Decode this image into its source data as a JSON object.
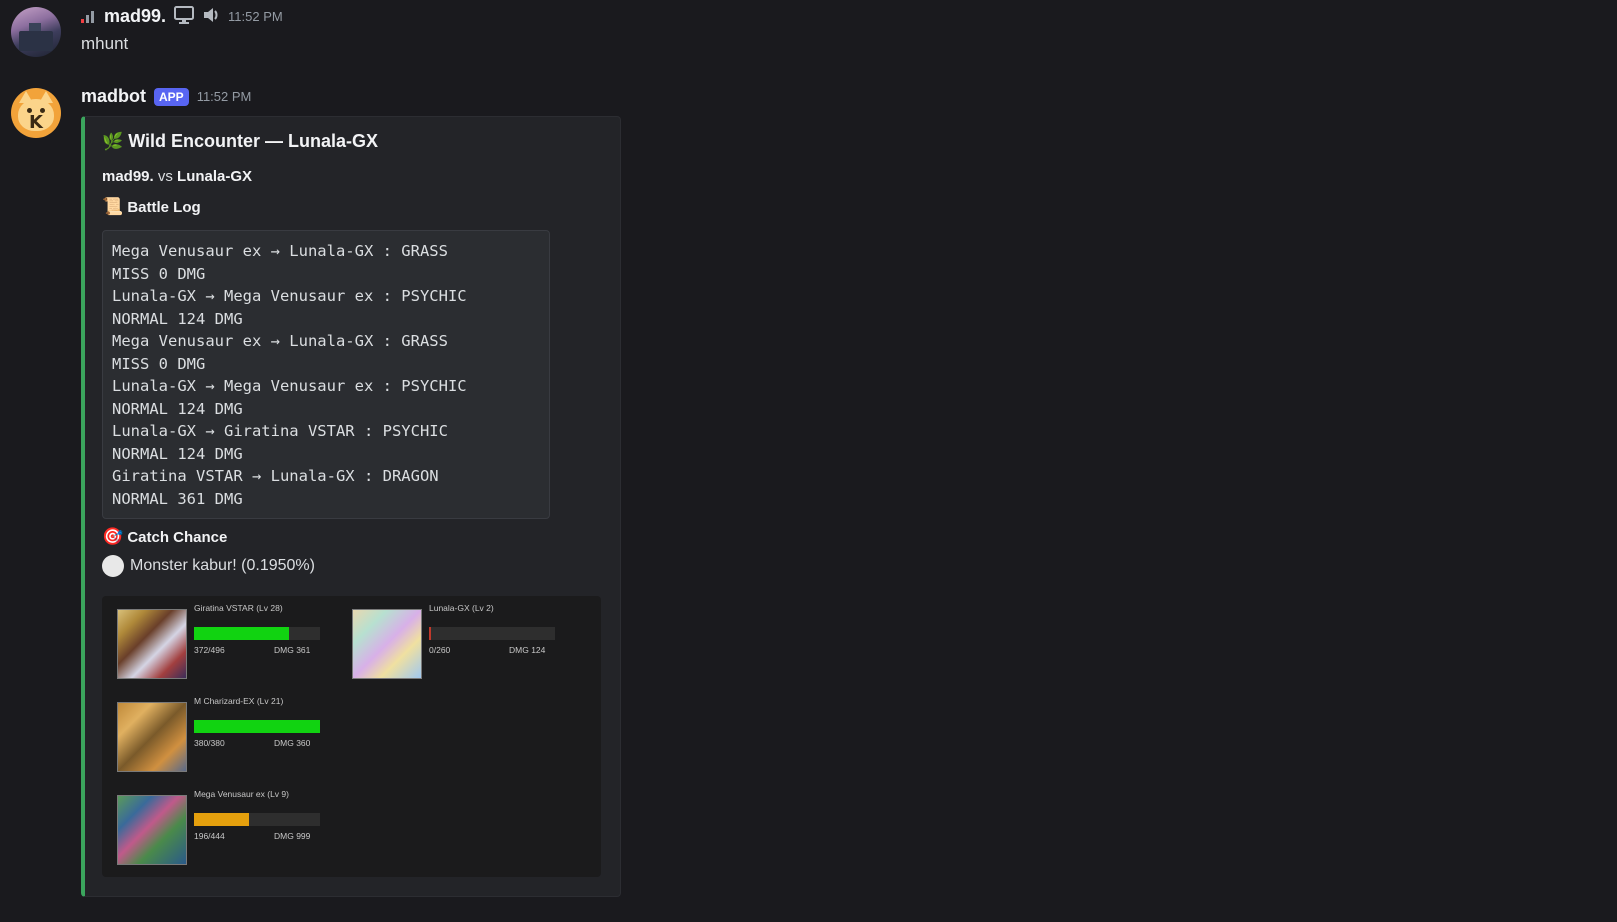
{
  "messages": [
    {
      "author": "mad99.",
      "timestamp": "11:52 PM",
      "content": "mhunt",
      "avatar_icon": "user-avatar"
    },
    {
      "author": "madbot",
      "badge": "APP",
      "timestamp": "11:52 PM",
      "avatar_icon": "cat-avatar",
      "avatar_letter": "K"
    }
  ],
  "embed": {
    "accent_color": "#3ba55d",
    "title_emoji": "🌿",
    "title": "Wild Encounter — Lunala-GX",
    "vs": {
      "player": "mad99.",
      "word": "vs",
      "opponent": "Lunala-GX"
    },
    "battle_log": {
      "emoji": "📜",
      "label": "Battle Log",
      "lines": [
        "Mega Venusaur ex → Lunala-GX : GRASS",
        "MISS 0 DMG",
        "Lunala-GX → Mega Venusaur ex : PSYCHIC",
        "NORMAL 124 DMG",
        "Mega Venusaur ex → Lunala-GX : GRASS",
        "MISS 0 DMG",
        "Lunala-GX → Mega Venusaur ex : PSYCHIC",
        "NORMAL 124 DMG",
        "Lunala-GX → Giratina VSTAR : PSYCHIC",
        "NORMAL 124 DMG",
        "Giratina VSTAR → Lunala-GX : DRAGON",
        "NORMAL 361 DMG"
      ]
    },
    "catch": {
      "emoji": "🎯",
      "label": "Catch Chance",
      "value": "Monster kabur! (0.1950%)"
    },
    "monsters": [
      {
        "name": "Giratina VSTAR (Lv 28)",
        "hp": "372/496",
        "dmg": "DMG 361",
        "hp_fraction": 0.75,
        "bar_color": "#11d311"
      },
      {
        "name": "Lunala-GX (Lv 2)",
        "hp": "0/260",
        "dmg": "DMG 124",
        "hp_fraction": 0.0,
        "bar_color": "#c0392b"
      },
      {
        "name": "M Charizard-EX (Lv 21)",
        "hp": "380/380",
        "dmg": "DMG 360",
        "hp_fraction": 1.0,
        "bar_color": "#11d311"
      },
      {
        "name": "Mega Venusaur ex (Lv 9)",
        "hp": "196/444",
        "dmg": "DMG 999",
        "hp_fraction": 0.44,
        "bar_color": "#e5a00d"
      }
    ]
  }
}
